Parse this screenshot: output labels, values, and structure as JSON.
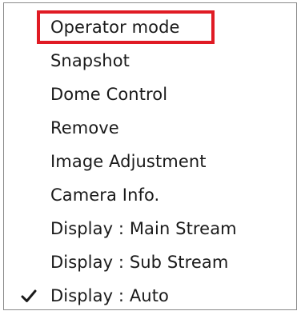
{
  "menu": {
    "items": [
      {
        "label": "Operator mode",
        "checked": false,
        "highlighted": true
      },
      {
        "label": "Snapshot",
        "checked": false,
        "highlighted": false
      },
      {
        "label": "Dome Control",
        "checked": false,
        "highlighted": false
      },
      {
        "label": "Remove",
        "checked": false,
        "highlighted": false
      },
      {
        "label": "Image Adjustment",
        "checked": false,
        "highlighted": false
      },
      {
        "label": "Camera Info.",
        "checked": false,
        "highlighted": false
      },
      {
        "label": "Display : Main Stream",
        "checked": false,
        "highlighted": false
      },
      {
        "label": "Display : Sub Stream",
        "checked": false,
        "highlighted": false
      },
      {
        "label": "Display : Auto",
        "checked": true,
        "highlighted": false
      }
    ],
    "check_icon": "checkmark-icon",
    "highlight_color": "#e01b24"
  }
}
